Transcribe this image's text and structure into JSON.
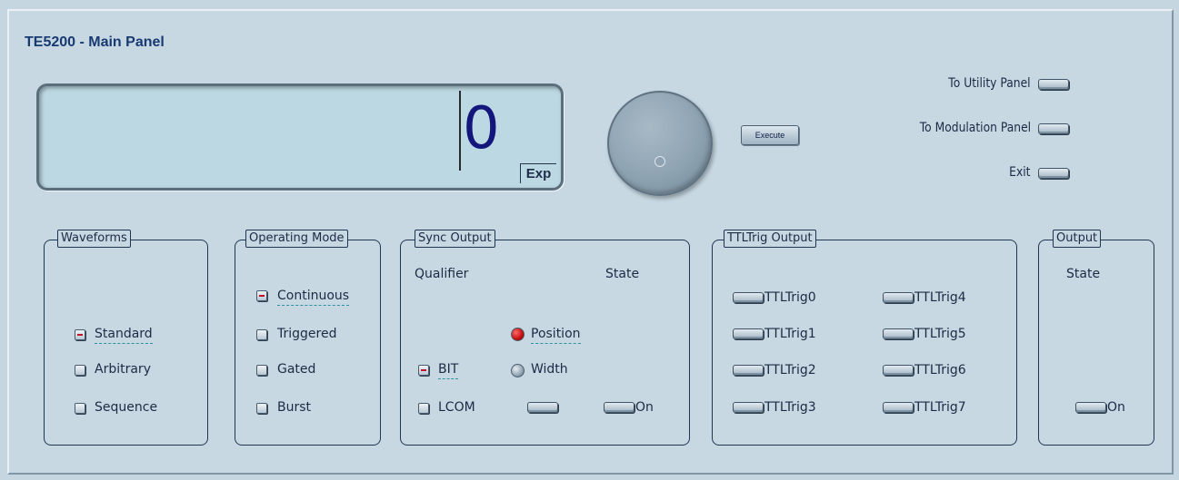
{
  "window": {
    "title": "TE5200 - Main Panel"
  },
  "display": {
    "value": "0",
    "exp_label": "Exp"
  },
  "execute_label": "Execute",
  "nav": {
    "utility": "To Utility Panel",
    "modulation": "To Modulation Panel",
    "exit": "Exit"
  },
  "waveforms": {
    "title": "Waveforms",
    "options": [
      "Standard",
      "Arbitrary",
      "Sequence"
    ],
    "selected": "Standard"
  },
  "operating_mode": {
    "title": "Operating Mode",
    "options": [
      "Continuous",
      "Triggered",
      "Gated",
      "Burst"
    ],
    "selected": "Continuous"
  },
  "sync_output": {
    "title": "Sync Output",
    "qualifier_header": "Qualifier",
    "state_header": "State",
    "position": "Position",
    "width": "Width",
    "bit": "BIT",
    "lcom": "LCOM",
    "state_on": "On",
    "qualifier_selected": "Position",
    "bit_checked": true
  },
  "ttltrig_output": {
    "title": "TTLTrig Output",
    "left": [
      "TTLTrig0",
      "TTLTrig1",
      "TTLTrig2",
      "TTLTrig3"
    ],
    "right": [
      "TTLTrig4",
      "TTLTrig5",
      "TTLTrig6",
      "TTLTrig7"
    ]
  },
  "output": {
    "title": "Output",
    "state_header": "State",
    "state_on": "On"
  }
}
